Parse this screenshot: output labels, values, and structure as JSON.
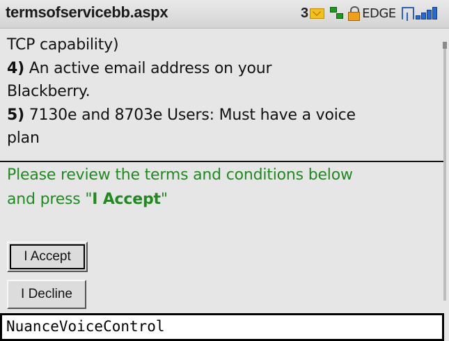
{
  "titlebar": {
    "title": "termsofservicebb.aspx",
    "status": {
      "message_count": "3",
      "message_icon": "envelope-icon",
      "network_icon": "network-activity-icon",
      "lock_icon": "lock-icon",
      "network_type": "EDGE",
      "signal_icon": "signal-strength-icon"
    }
  },
  "content": {
    "lines": [
      {
        "num": "",
        "text": "TCP capability)"
      },
      {
        "num": "4)",
        "text": " An active email address on your"
      },
      {
        "num": "",
        "text": "Blackberry."
      },
      {
        "num": "5)",
        "text": " 7130e and 8703e Users: Must have a voice"
      },
      {
        "num": "",
        "text": "plan"
      }
    ]
  },
  "notice": {
    "line1": "Please review the terms and conditions below",
    "line2_prefix": "and press \"",
    "line2_strong": "I Accept",
    "line2_suffix": "\""
  },
  "buttons": {
    "accept": "I Accept",
    "decline": "I Decline"
  },
  "terms_box": {
    "value": "NuanceVoiceControl"
  },
  "colors": {
    "notice": "#1f8a1f",
    "background": "#e6e6e6"
  }
}
